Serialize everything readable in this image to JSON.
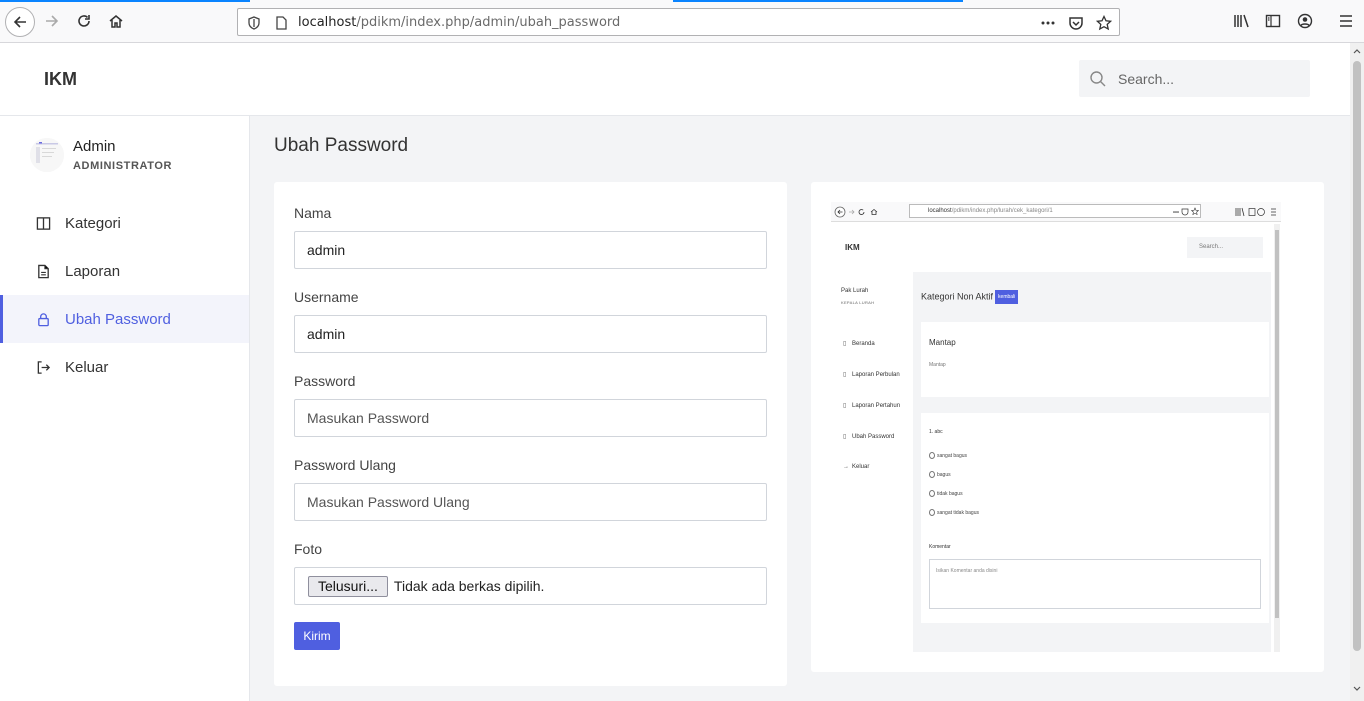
{
  "browser": {
    "url_host": "localhost",
    "url_path": "/pdikm/index.php/admin/ubah_password"
  },
  "header": {
    "brand": "IKM",
    "search_placeholder": "Search..."
  },
  "sidebar": {
    "user_name": "Admin",
    "user_role": "ADMINISTRATOR",
    "items": [
      {
        "label": "Kategori",
        "icon": "book-icon"
      },
      {
        "label": "Laporan",
        "icon": "file-icon"
      },
      {
        "label": "Ubah Password",
        "icon": "lock-icon",
        "active": true
      },
      {
        "label": "Keluar",
        "icon": "logout-icon"
      }
    ]
  },
  "main": {
    "title": "Ubah Password",
    "form": {
      "nama_label": "Nama",
      "nama_value": "admin",
      "username_label": "Username",
      "username_value": "admin",
      "password_label": "Password",
      "password_placeholder": "Masukan Password",
      "password_ulang_label": "Password Ulang",
      "password_ulang_placeholder": "Masukan Password Ulang",
      "foto_label": "Foto",
      "file_button": "Telusuri...",
      "file_status": "Tidak ada berkas dipilih.",
      "submit": "Kirim"
    },
    "photo_preview": {
      "url_host": "localhost",
      "url_path": "/pdikm/index.php/lurah/cek_kategori/1",
      "brand": "IKM",
      "search": "Search...",
      "user_name": "Pak Lurah",
      "user_role": "KEPALA LURAH",
      "menu": [
        "Beranda",
        "Laporan Perbulan",
        "Laporan Pertahun",
        "Ubah Password",
        "Keluar"
      ],
      "title": "Kategori Non Aktif",
      "badge": "kembali",
      "card1_title": "Mantap",
      "card1_text": "Mantap",
      "question": "1. abc",
      "options": [
        "sangat bagus",
        "bagus",
        "tidak bagus",
        "sangat tidak bagus"
      ],
      "komentar_label": "Komentar",
      "komentar_placeholder": "Isikan Komentar anda disini"
    }
  },
  "colors": {
    "accent": "#4f5fe0",
    "main_bg": "#f3f4f6"
  }
}
